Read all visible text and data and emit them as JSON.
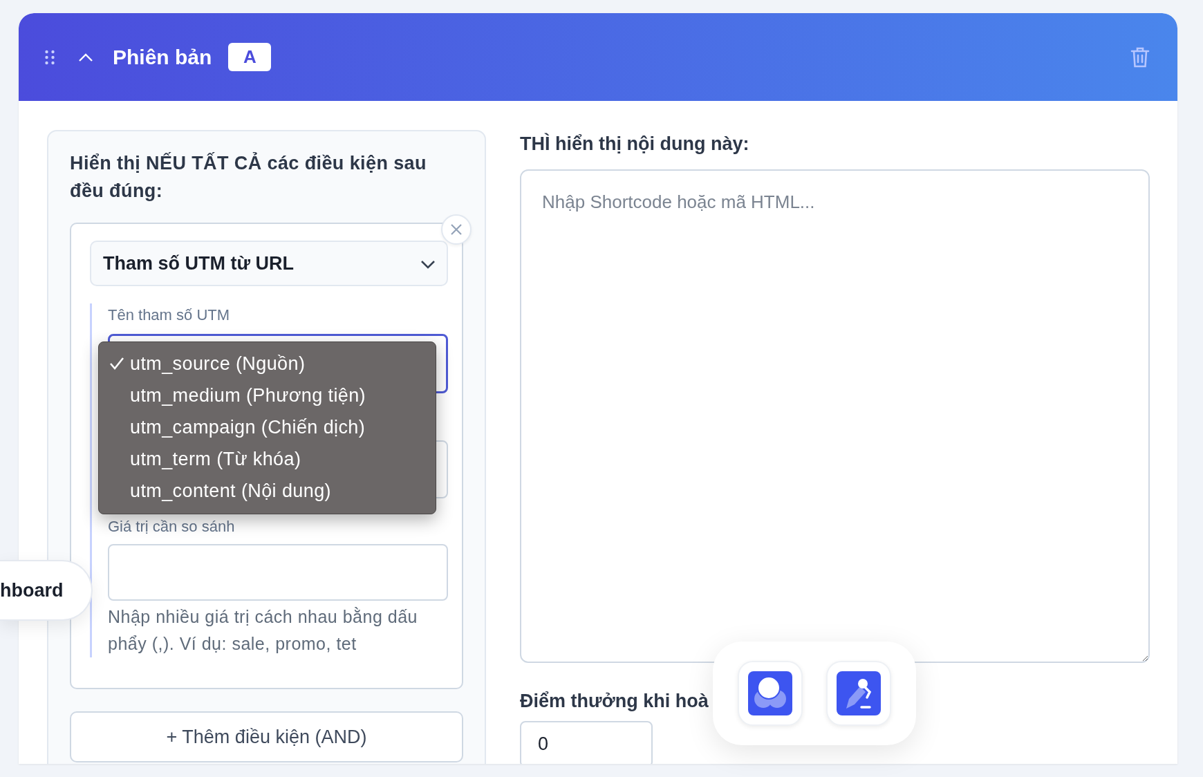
{
  "variant_header": {
    "title": "Phiên bản",
    "badge": "A",
    "expanded": true
  },
  "conditions": {
    "heading": "Hiển thị NẾU TẤT CẢ các điều kiện sau đều đúng:",
    "items": [
      {
        "type_select": "Tham số UTM từ URL",
        "param_label": "Tên tham số UTM",
        "dropdown_open": true,
        "options": [
          {
            "label": "utm_source (Nguồn)",
            "selected": true
          },
          {
            "label": "utm_medium (Phương tiện)",
            "selected": false
          },
          {
            "label": "utm_campaign (Chiến dịch)",
            "selected": false
          },
          {
            "label": "utm_term (Từ khóa)",
            "selected": false
          },
          {
            "label": "utm_content (Nội dung)",
            "selected": false
          }
        ],
        "value_label": "Giá trị cần so sánh",
        "help": "Nhập nhiều giá trị cách nhau bằng dấu phẩy (,). Ví dụ: sale, promo, tet"
      }
    ],
    "add_button": "+ Thêm điều kiện (AND)"
  },
  "content": {
    "heading": "THÌ hiển thị nội dung này:",
    "placeholder": "Nhập Shortcode hoặc mã HTML..."
  },
  "reward": {
    "label": "Điểm thưởng khi hoà",
    "value": "0"
  },
  "side_pill": {
    "label": "hboard"
  }
}
